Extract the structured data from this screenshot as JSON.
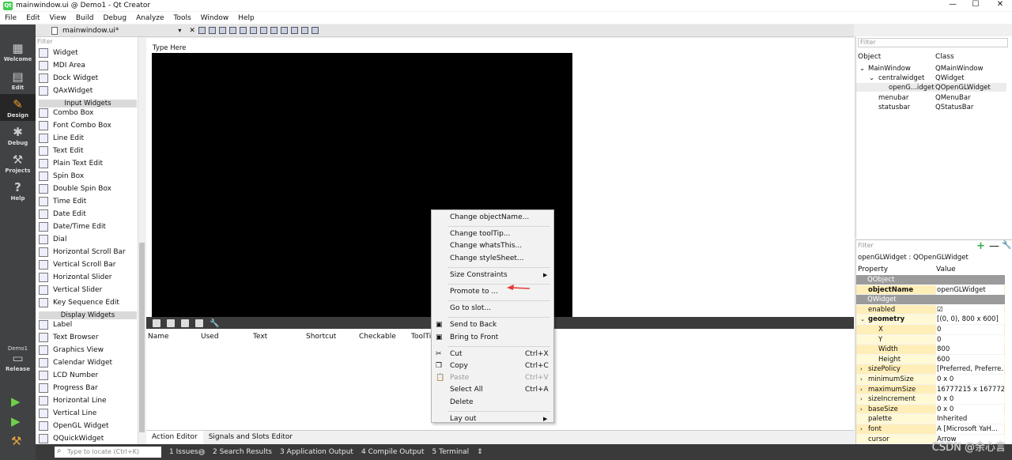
{
  "window": {
    "title": "mainwindow.ui @ Demo1 - Qt Creator",
    "minimize": "—",
    "maximize": "☐",
    "close": "✕"
  },
  "menubar": [
    "File",
    "Edit",
    "View",
    "Build",
    "Debug",
    "Analyze",
    "Tools",
    "Window",
    "Help"
  ],
  "modes": [
    {
      "label": "Welcome",
      "icon": "grid-icon"
    },
    {
      "label": "Edit",
      "icon": "edit-icon"
    },
    {
      "label": "Design",
      "icon": "pen-icon"
    },
    {
      "label": "Debug",
      "icon": "bug-icon"
    },
    {
      "label": "Projects",
      "icon": "wrench-icon"
    },
    {
      "label": "Help",
      "icon": "question-icon"
    }
  ],
  "kit": {
    "project": "Demo1",
    "config": "Release"
  },
  "editor": {
    "file_name": "mainwindow.ui*"
  },
  "widget_box": {
    "filter_placeholder": "Filter",
    "items": [
      {
        "label": "Widget",
        "type": "item"
      },
      {
        "label": "MDI Area",
        "type": "item"
      },
      {
        "label": "Dock Widget",
        "type": "item"
      },
      {
        "label": "QAxWidget",
        "type": "item"
      },
      {
        "label": "Input Widgets",
        "type": "category"
      },
      {
        "label": "Combo Box",
        "type": "item"
      },
      {
        "label": "Font Combo Box",
        "type": "item"
      },
      {
        "label": "Line Edit",
        "type": "item"
      },
      {
        "label": "Text Edit",
        "type": "item"
      },
      {
        "label": "Plain Text Edit",
        "type": "item"
      },
      {
        "label": "Spin Box",
        "type": "item"
      },
      {
        "label": "Double Spin Box",
        "type": "item"
      },
      {
        "label": "Time Edit",
        "type": "item"
      },
      {
        "label": "Date Edit",
        "type": "item"
      },
      {
        "label": "Date/Time Edit",
        "type": "item"
      },
      {
        "label": "Dial",
        "type": "item"
      },
      {
        "label": "Horizontal Scroll Bar",
        "type": "item"
      },
      {
        "label": "Vertical Scroll Bar",
        "type": "item"
      },
      {
        "label": "Horizontal Slider",
        "type": "item"
      },
      {
        "label": "Vertical Slider",
        "type": "item"
      },
      {
        "label": "Key Sequence Edit",
        "type": "item"
      },
      {
        "label": "Display Widgets",
        "type": "category"
      },
      {
        "label": "Label",
        "type": "item"
      },
      {
        "label": "Text Browser",
        "type": "item"
      },
      {
        "label": "Graphics View",
        "type": "item"
      },
      {
        "label": "Calendar Widget",
        "type": "item"
      },
      {
        "label": "LCD Number",
        "type": "item"
      },
      {
        "label": "Progress Bar",
        "type": "item"
      },
      {
        "label": "Horizontal Line",
        "type": "item"
      },
      {
        "label": "Vertical Line",
        "type": "item"
      },
      {
        "label": "OpenGL Widget",
        "type": "item"
      },
      {
        "label": "QQuickWidget",
        "type": "item"
      }
    ]
  },
  "form": {
    "menu_placeholder": "Type Here"
  },
  "action_editor": {
    "columns": [
      "Name",
      "Used",
      "Text",
      "Shortcut",
      "Checkable",
      "ToolTip"
    ],
    "tabs": [
      "Action Editor",
      "Signals and Slots Editor"
    ]
  },
  "context_menu": {
    "items": [
      {
        "label": "Change objectName...",
        "shortcut": "",
        "submenu": false,
        "disabled": false,
        "icon": ""
      },
      {
        "sep": true
      },
      {
        "label": "Change toolTip...",
        "shortcut": "",
        "submenu": false,
        "disabled": false,
        "icon": ""
      },
      {
        "label": "Change whatsThis...",
        "shortcut": "",
        "submenu": false,
        "disabled": false,
        "icon": ""
      },
      {
        "label": "Change styleSheet...",
        "shortcut": "",
        "submenu": false,
        "disabled": false,
        "icon": ""
      },
      {
        "sep": true
      },
      {
        "label": "Size Constraints",
        "shortcut": "",
        "submenu": true,
        "disabled": false,
        "icon": ""
      },
      {
        "sep": true
      },
      {
        "label": "Promote to ...",
        "shortcut": "",
        "submenu": false,
        "disabled": false,
        "icon": ""
      },
      {
        "sep": true
      },
      {
        "label": "Go to slot...",
        "shortcut": "",
        "submenu": false,
        "disabled": false,
        "icon": ""
      },
      {
        "sep": true
      },
      {
        "label": "Send to Back",
        "shortcut": "",
        "submenu": false,
        "disabled": false,
        "icon": "send-back-icon"
      },
      {
        "label": "Bring to Front",
        "shortcut": "",
        "submenu": false,
        "disabled": false,
        "icon": "bring-front-icon"
      },
      {
        "sep": true
      },
      {
        "label": "Cut",
        "shortcut": "Ctrl+X",
        "submenu": false,
        "disabled": false,
        "icon": "scissors-icon"
      },
      {
        "label": "Copy",
        "shortcut": "Ctrl+C",
        "submenu": false,
        "disabled": false,
        "icon": "copy-icon"
      },
      {
        "label": "Paste",
        "shortcut": "Ctrl+V",
        "submenu": false,
        "disabled": true,
        "icon": "paste-icon"
      },
      {
        "label": "Select All",
        "shortcut": "Ctrl+A",
        "submenu": false,
        "disabled": false,
        "icon": ""
      },
      {
        "label": "Delete",
        "shortcut": "",
        "submenu": false,
        "disabled": false,
        "icon": ""
      },
      {
        "sep": true
      },
      {
        "label": "Lay out",
        "shortcut": "",
        "submenu": true,
        "disabled": false,
        "icon": ""
      }
    ]
  },
  "object_inspector": {
    "filter_placeholder": "Filter",
    "headers": {
      "object": "Object",
      "class": "Class"
    },
    "rows": [
      {
        "object": "MainWindow",
        "class": "QMainWindow",
        "indent": 0,
        "expand": "⌄"
      },
      {
        "object": "centralwidget",
        "class": "QWidget",
        "indent": 1,
        "expand": "⌄"
      },
      {
        "object": "openG...idget",
        "class": "QOpenGLWidget",
        "indent": 2,
        "expand": ""
      },
      {
        "object": "menubar",
        "class": "QMenuBar",
        "indent": 1,
        "expand": ""
      },
      {
        "object": "statusbar",
        "class": "QStatusBar",
        "indent": 1,
        "expand": ""
      }
    ]
  },
  "property_editor": {
    "filter_placeholder": "Filter",
    "plus": "+",
    "minus": "—",
    "wrench": "🔧",
    "object_class": "openGLWidget : QOpenGLWidget",
    "headers": {
      "property": "Property",
      "value": "Value"
    },
    "rows": [
      {
        "kind": "section",
        "name": "QObject"
      },
      {
        "kind": "prop",
        "name": "objectName",
        "value": "openGLWidget",
        "bold": true,
        "sub": false,
        "expand": ""
      },
      {
        "kind": "section",
        "name": "QWidget"
      },
      {
        "kind": "prop",
        "name": "enabled",
        "value": "☑",
        "bold": false,
        "sub": false,
        "expand": ""
      },
      {
        "kind": "prop",
        "name": "geometry",
        "value": "[(0, 0), 800 x 600]",
        "bold": true,
        "sub": false,
        "expand": "⌄"
      },
      {
        "kind": "prop",
        "name": "X",
        "value": "0",
        "bold": false,
        "sub": true,
        "expand": ""
      },
      {
        "kind": "prop",
        "name": "Y",
        "value": "0",
        "bold": false,
        "sub": true,
        "expand": ""
      },
      {
        "kind": "prop",
        "name": "Width",
        "value": "800",
        "bold": false,
        "sub": true,
        "expand": ""
      },
      {
        "kind": "prop",
        "name": "Height",
        "value": "600",
        "bold": false,
        "sub": true,
        "expand": ""
      },
      {
        "kind": "prop",
        "name": "sizePolicy",
        "value": "[Preferred, Preferre...",
        "bold": false,
        "sub": false,
        "expand": "›"
      },
      {
        "kind": "prop",
        "name": "minimumSize",
        "value": "0 x 0",
        "bold": false,
        "sub": false,
        "expand": "›"
      },
      {
        "kind": "prop",
        "name": "maximumSize",
        "value": "16777215 x 167772...",
        "bold": false,
        "sub": false,
        "expand": "›"
      },
      {
        "kind": "prop",
        "name": "sizeIncrement",
        "value": "0 x 0",
        "bold": false,
        "sub": false,
        "expand": "›"
      },
      {
        "kind": "prop",
        "name": "baseSize",
        "value": "0 x 0",
        "bold": false,
        "sub": false,
        "expand": "›"
      },
      {
        "kind": "prop",
        "name": "palette",
        "value": "Inherited",
        "bold": false,
        "sub": false,
        "expand": ""
      },
      {
        "kind": "prop",
        "name": "font",
        "value": "A  [Microsoft YaH...",
        "bold": false,
        "sub": false,
        "expand": "›"
      },
      {
        "kind": "prop",
        "name": "cursor",
        "value": "Arrow",
        "bold": false,
        "sub": false,
        "expand": ""
      }
    ]
  },
  "statusbar": {
    "locator_placeholder": "Type to locate (Ctrl+K)",
    "panes": [
      {
        "num": "1",
        "label": "Issues",
        "badge": "1"
      },
      {
        "num": "2",
        "label": "Search Results",
        "badge": ""
      },
      {
        "num": "3",
        "label": "Application Output",
        "badge": ""
      },
      {
        "num": "4",
        "label": "Compile Output",
        "badge": ""
      },
      {
        "num": "5",
        "label": "Terminal",
        "badge": ""
      }
    ],
    "more": "⇕"
  },
  "watermark": "CSDN @余心言"
}
